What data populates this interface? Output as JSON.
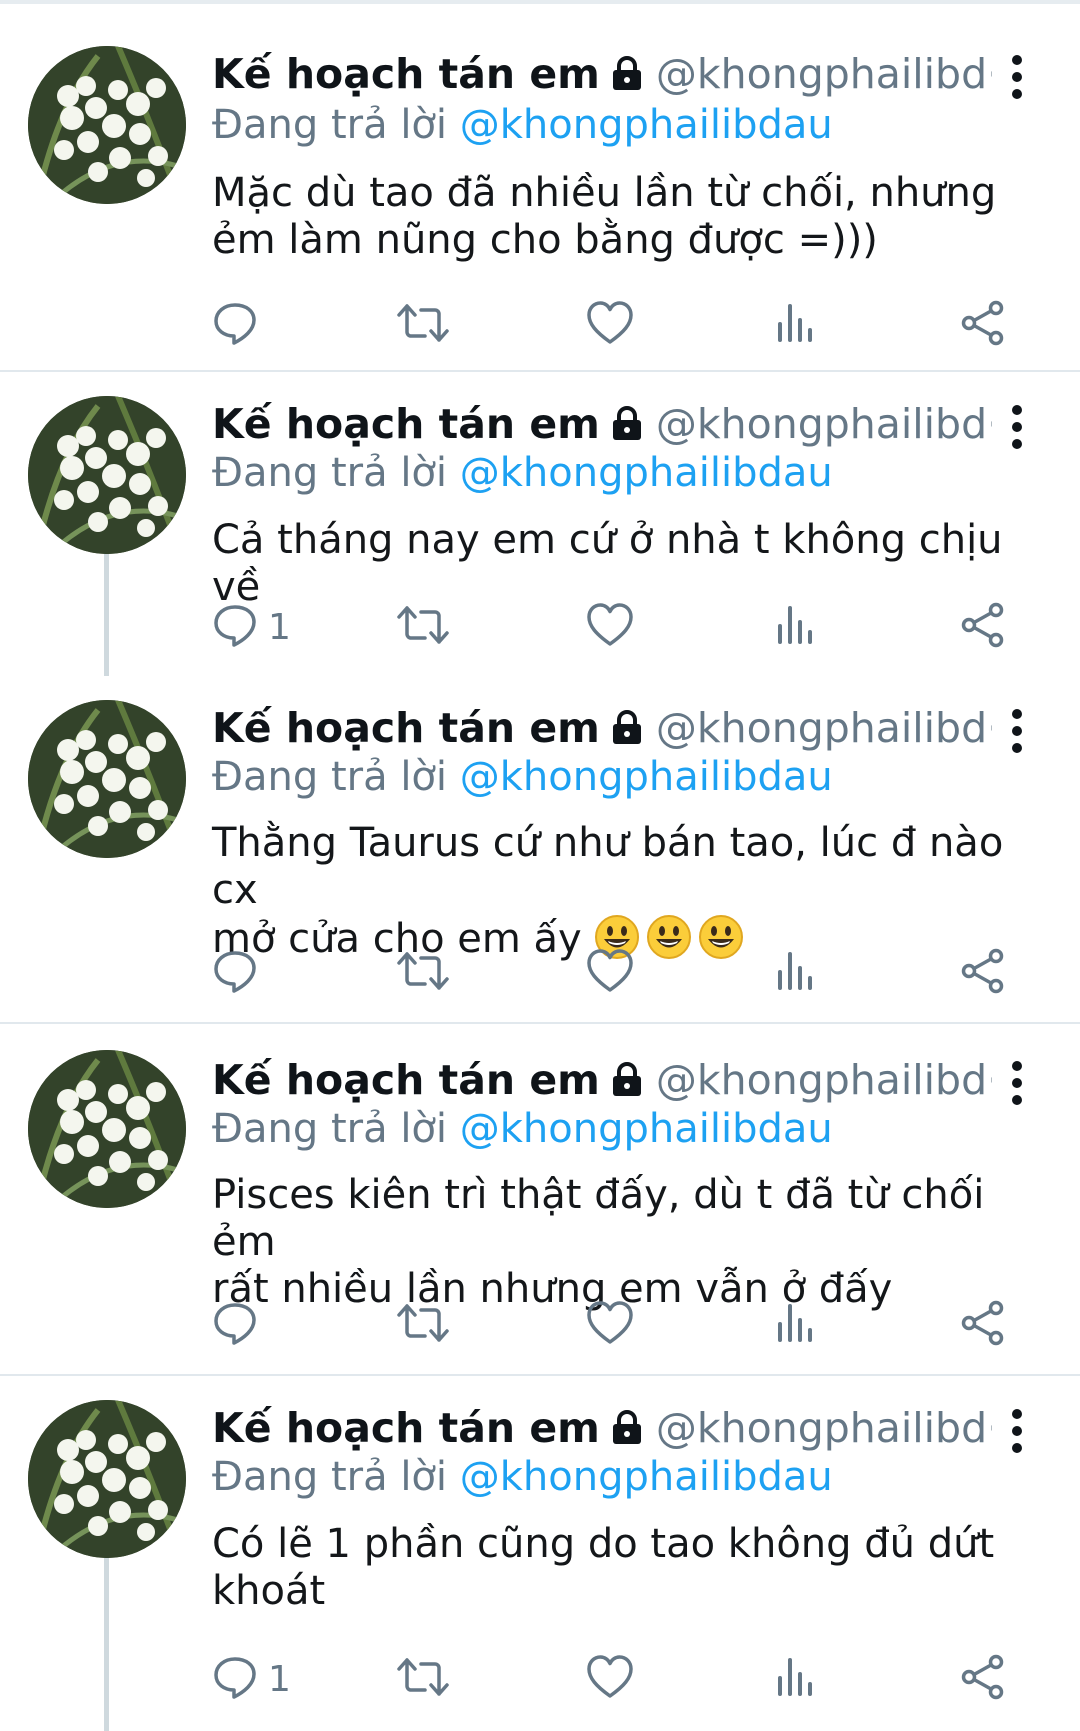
{
  "tweets": [
    {
      "author_name": "Kế hoạch tán em",
      "author_handle": "@khongphailibd",
      "ellipsis": "···",
      "reply_prefix": "Đang trả lời",
      "reply_to": "@khongphailibdau",
      "text_lines": [
        "Mặc dù tao đã nhiều lần từ chối, nhưng",
        "ẻm làm nũng cho bằng được =)))"
      ],
      "reply_count": ""
    },
    {
      "author_name": "Kế hoạch tán em",
      "author_handle": "@khongphailibd",
      "ellipsis": "···",
      "reply_prefix": "Đang trả lời",
      "reply_to": "@khongphailibdau",
      "text_lines": [
        "Cả tháng nay em cứ ở nhà t không chịu về"
      ],
      "reply_count": "1"
    },
    {
      "author_name": "Kế hoạch tán em",
      "author_handle": "@khongphailibd",
      "ellipsis": "···",
      "reply_prefix": "Đang trả lời",
      "reply_to": "@khongphailibdau",
      "text_lines": [
        "Thằng Taurus cứ như bán tao, lúc đ nào cx",
        "mở cửa cho em ấy"
      ],
      "emoji": "😃😃😃",
      "reply_count": ""
    },
    {
      "author_name": "Kế hoạch tán em",
      "author_handle": "@khongphailibd",
      "ellipsis": "···",
      "reply_prefix": "Đang trả lời",
      "reply_to": "@khongphailibdau",
      "text_lines": [
        "Pisces kiên trì thật đấy, dù t đã từ chối ẻm",
        "rất nhiều lần nhưng em vẫn ở đấy"
      ],
      "reply_count": ""
    },
    {
      "author_name": "Kế hoạch tán em",
      "author_handle": "@khongphailibd",
      "ellipsis": "···",
      "reply_prefix": "Đang trả lời",
      "reply_to": "@khongphailibdau",
      "text_lines": [
        "Có lẽ 1 phần cũng do tao không đủ dứt",
        "khoát"
      ],
      "reply_count": "1"
    }
  ],
  "icons": {
    "reply": "reply-icon",
    "retweet": "retweet-icon",
    "like": "heart-icon",
    "analytics": "analytics-icon",
    "share": "share-icon",
    "more": "more-vertical-icon",
    "lock": "lock-icon"
  },
  "colors": {
    "link": "#1da1f2",
    "muted": "#657786",
    "icon": "#657786",
    "separator": "#e1e8ed"
  }
}
